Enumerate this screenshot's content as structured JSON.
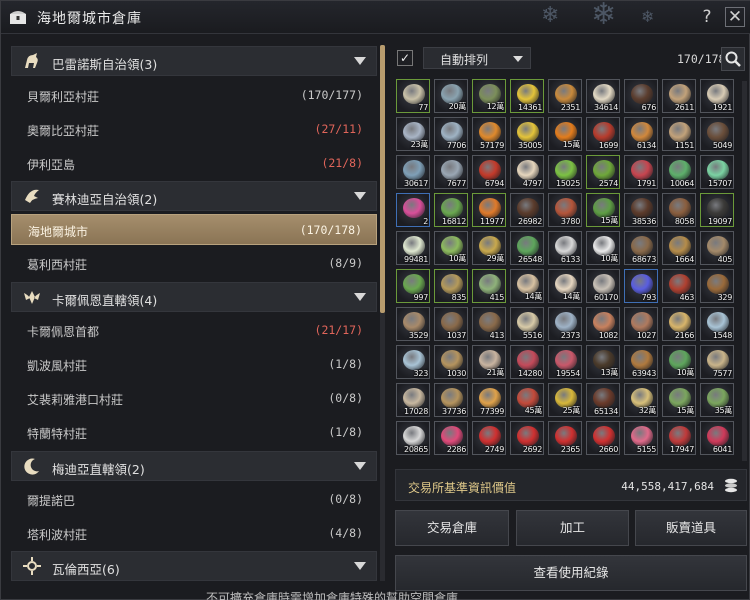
{
  "window": {
    "title": "海地爾城市倉庫",
    "help_icon": "?",
    "close_icon": "✕"
  },
  "left": {
    "regions": [
      {
        "name": "巴雷諾斯自治領(3)",
        "icon": "horse-icon"
      },
      {
        "name": "賽林迪亞自治領(2)",
        "icon": "bird-icon"
      },
      {
        "name": "卡爾佩恩直轄領(4)",
        "icon": "wing-crest-icon"
      },
      {
        "name": "梅迪亞直轄領(2)",
        "icon": "moon-icon"
      },
      {
        "name": "瓦倫西亞(6)",
        "icon": "sun-crest-icon"
      }
    ],
    "towns": [
      {
        "name": "貝爾利亞村莊",
        "count": "(170/177)",
        "status": "normal"
      },
      {
        "name": "奧爾比亞村莊",
        "count": "(27/11)",
        "status": "over"
      },
      {
        "name": "伊利亞島",
        "count": "(21/8)",
        "status": "over"
      },
      {
        "name": "海地爾城市",
        "count": "(170/178)",
        "status": "selected"
      },
      {
        "name": "葛利西村莊",
        "count": "(8/9)",
        "status": "normal"
      },
      {
        "name": "卡爾佩恩首都",
        "count": "(21/17)",
        "status": "over"
      },
      {
        "name": "凱波風村莊",
        "count": "(1/8)",
        "status": "normal"
      },
      {
        "name": "艾裴莉雅港口村莊",
        "count": "(0/8)",
        "status": "normal"
      },
      {
        "name": "特蘭特村莊",
        "count": "(1/8)",
        "status": "normal"
      },
      {
        "name": "爾提諾巴",
        "count": "(0/8)",
        "status": "normal"
      },
      {
        "name": "塔利波村莊",
        "count": "(4/8)",
        "status": "normal"
      }
    ]
  },
  "toolbar": {
    "autosort_checked": "✓",
    "sort_label": "自動排列",
    "capacity": "170/178",
    "search_icon": "search-icon"
  },
  "inventory": {
    "rows": [
      [
        "77",
        "20萬",
        "12萬",
        "14361",
        "2351",
        "34614",
        "676",
        "2611",
        "1921"
      ],
      [
        "23萬",
        "7706",
        "57179",
        "35005",
        "15萬",
        "1699",
        "6134",
        "1151",
        "5049"
      ],
      [
        "30617",
        "7677",
        "6794",
        "4797",
        "15025",
        "2574",
        "1791",
        "10064",
        "15707"
      ],
      [
        "2",
        "16812",
        "11977",
        "26982",
        "3780",
        "15萬",
        "38536",
        "8058",
        "19097"
      ],
      [
        "99481",
        "10萬",
        "29萬",
        "26548",
        "6133",
        "10萬",
        "68673",
        "1664",
        "405"
      ],
      [
        "997",
        "835",
        "415",
        "14萬",
        "14萬",
        "60170",
        "793",
        "463",
        "329"
      ],
      [
        "3529",
        "1037",
        "413",
        "5516",
        "2373",
        "1082",
        "1027",
        "2166",
        "1548"
      ],
      [
        "323",
        "1030",
        "21萬",
        "14280",
        "19554",
        "13萬",
        "63943",
        "10萬",
        "7577"
      ],
      [
        "17028",
        "37736",
        "77399",
        "45萬",
        "25萬",
        "65134",
        "32萬",
        "15萬",
        "35萬"
      ],
      [
        "20865",
        "2286",
        "2749",
        "2692",
        "2365",
        "2660",
        "5155",
        "17947",
        "6041"
      ]
    ],
    "tints": [
      [
        "#c9c1a8",
        "#8aa3b0",
        "#7c8f5a",
        "#e4c43a",
        "#c98a3c",
        "#e3d9c4",
        "#5b3d2e",
        "#c2a27a",
        "#d9ccb5"
      ],
      [
        "#a9b5c6",
        "#9fb3c4",
        "#e08a2c",
        "#e4c43a",
        "#e37c1c",
        "#b73b2c",
        "#d1883c",
        "#c2a27a",
        "#6a4e3a"
      ],
      [
        "#7fa0b8",
        "#9aa7b4",
        "#c43a2a",
        "#e6d6bd",
        "#7cc243",
        "#6fa83a",
        "#c8454f",
        "#5eb06b",
        "#7bd3a3"
      ],
      [
        "#d94f9a",
        "#6aa84f",
        "#e07a2a",
        "#5a3b2b",
        "#b5553a",
        "#5e9e44",
        "#5b3a2a",
        "#8a5e3e",
        "#3b3a38"
      ],
      [
        "#dfe8d0",
        "#8dbb5e",
        "#c9a94d",
        "#5ea65c",
        "#d8d8d8",
        "#e9e9e9",
        "#8a6a4a",
        "#b58c4a",
        "#a48a6a"
      ],
      [
        "#6aa84f",
        "#b59a5a",
        "#8fb27a",
        "#d8c2a2",
        "#e6d6c0",
        "#c9c1b7",
        "#5a5ee0",
        "#b04030",
        "#9a6a3a"
      ],
      [
        "#a88a6a",
        "#8a6a4a",
        "#8a6a4a",
        "#d8cba8",
        "#9fb3c7",
        "#c8815e",
        "#b07a5e",
        "#d8b56a",
        "#a9c4d6"
      ],
      [
        "#a9c4d6",
        "#b5945e",
        "#c9b4a0",
        "#c44a5a",
        "#c9586a",
        "#4a3a2a",
        "#b07a3e",
        "#5ea65c",
        "#c9b48a"
      ],
      [
        "#c8b8a0",
        "#b5945e",
        "#e0a24a",
        "#c44a3a",
        "#d8b83a",
        "#6a3a2a",
        "#d8c07a",
        "#7ba65e",
        "#7ba65e"
      ],
      [
        "#d8d8d8",
        "#e04a7a",
        "#d03030",
        "#d03030",
        "#d03030",
        "#d03030",
        "#e06a8a",
        "#c03a3a",
        "#d03a5a"
      ]
    ],
    "borders": [
      [
        "g",
        "n",
        "g",
        "g",
        "n",
        "n",
        "n",
        "n",
        "n"
      ],
      [
        "n",
        "n",
        "n",
        "n",
        "n",
        "n",
        "n",
        "n",
        "n"
      ],
      [
        "n",
        "n",
        "n",
        "n",
        "n",
        "g",
        "n",
        "n",
        "n"
      ],
      [
        "b",
        "g",
        "g",
        "n",
        "n",
        "g",
        "n",
        "n",
        "g"
      ],
      [
        "n",
        "n",
        "n",
        "n",
        "n",
        "n",
        "n",
        "n",
        "n"
      ],
      [
        "g",
        "g",
        "g",
        "n",
        "n",
        "n",
        "b",
        "n",
        "n"
      ],
      [
        "n",
        "n",
        "n",
        "n",
        "n",
        "n",
        "n",
        "n",
        "n"
      ],
      [
        "n",
        "n",
        "n",
        "n",
        "n",
        "n",
        "n",
        "n",
        "n"
      ],
      [
        "n",
        "n",
        "n",
        "n",
        "n",
        "n",
        "n",
        "n",
        "n"
      ],
      [
        "n",
        "n",
        "n",
        "n",
        "n",
        "n",
        "n",
        "n",
        "n"
      ]
    ]
  },
  "value": {
    "label": "交易所基準資訊價值",
    "amount": "44,558,417,684"
  },
  "buttons": {
    "exchange": "交易倉庫",
    "craft": "加工",
    "sell": "販賣道具",
    "history": "查看使用紀錄"
  },
  "footer": {
    "text": "不可擴充倉庫時需增加倉庫特殊的幫助空間倉庫"
  },
  "colors": {
    "accent": "#b89c6e",
    "over_count": "#e0655a",
    "selected_bg": "#9a8462"
  }
}
